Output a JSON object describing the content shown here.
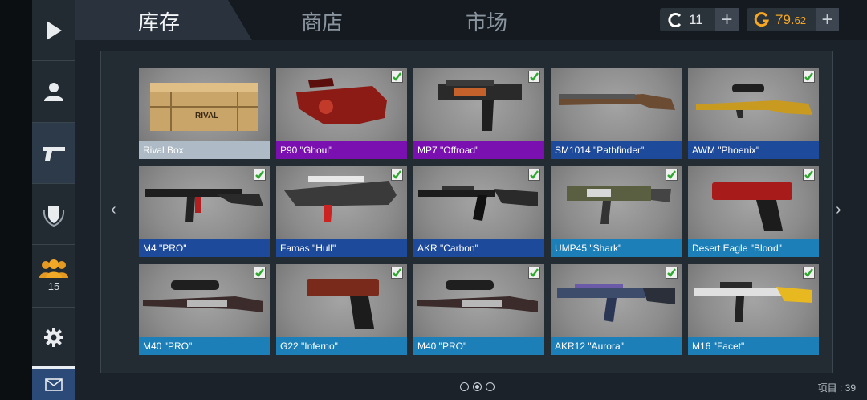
{
  "tabs": [
    {
      "label": "库存",
      "active": true
    },
    {
      "label": "商店",
      "active": false
    },
    {
      "label": "市场",
      "active": false
    }
  ],
  "currency": {
    "credits": {
      "icon": "credits-c-icon",
      "value": "11",
      "color": "#ffffff"
    },
    "gold": {
      "icon": "gold-g-icon",
      "value_int": "79.",
      "value_frac": "62",
      "color": "#f5a623"
    },
    "plus": "+"
  },
  "sidebar": {
    "items": [
      {
        "name": "play-icon"
      },
      {
        "name": "profile-icon"
      },
      {
        "name": "inventory-pistol-icon",
        "active": true
      },
      {
        "name": "clan-shield-icon"
      },
      {
        "name": "friends-icon",
        "count": "15"
      },
      {
        "name": "settings-gear-icon"
      },
      {
        "name": "mail-icon"
      }
    ]
  },
  "nav": {
    "prev": "‹",
    "next": "›"
  },
  "items": [
    {
      "label": "Rival Box",
      "rarity": "common",
      "checked": false,
      "kind": "box"
    },
    {
      "label": "P90 \"Ghoul\"",
      "rarity": "purple",
      "checked": true,
      "kind": "p90"
    },
    {
      "label": "MP7 \"Offroad\"",
      "rarity": "purple",
      "checked": true,
      "kind": "mp7"
    },
    {
      "label": "SM1014 \"Pathfinder\"",
      "rarity": "blue",
      "checked": false,
      "kind": "shotgun"
    },
    {
      "label": "AWM \"Phoenix\"",
      "rarity": "blue",
      "checked": true,
      "kind": "sniper"
    },
    {
      "label": "M4 \"PRO\"",
      "rarity": "blue",
      "checked": true,
      "kind": "rifle"
    },
    {
      "label": "Famas \"Hull\"",
      "rarity": "blue",
      "checked": true,
      "kind": "famas"
    },
    {
      "label": "AKR \"Carbon\"",
      "rarity": "blue",
      "checked": true,
      "kind": "ak"
    },
    {
      "label": "UMP45 \"Shark\"",
      "rarity": "light",
      "checked": true,
      "kind": "smg"
    },
    {
      "label": "Desert Eagle \"Blood\"",
      "rarity": "light",
      "checked": true,
      "kind": "pistol"
    },
    {
      "label": "M40 \"PRO\"",
      "rarity": "light",
      "checked": true,
      "kind": "sniper2"
    },
    {
      "label": "G22 \"Inferno\"",
      "rarity": "light",
      "checked": true,
      "kind": "glock"
    },
    {
      "label": "M40 \"PRO\"",
      "rarity": "light",
      "checked": true,
      "kind": "sniper2"
    },
    {
      "label": "AKR12 \"Aurora\"",
      "rarity": "light",
      "checked": true,
      "kind": "ak12"
    },
    {
      "label": "M16 \"Facet\"",
      "rarity": "light",
      "checked": true,
      "kind": "m16"
    }
  ],
  "pagination": {
    "pages": 3,
    "current": 2
  },
  "items_count": "项目 : 39"
}
